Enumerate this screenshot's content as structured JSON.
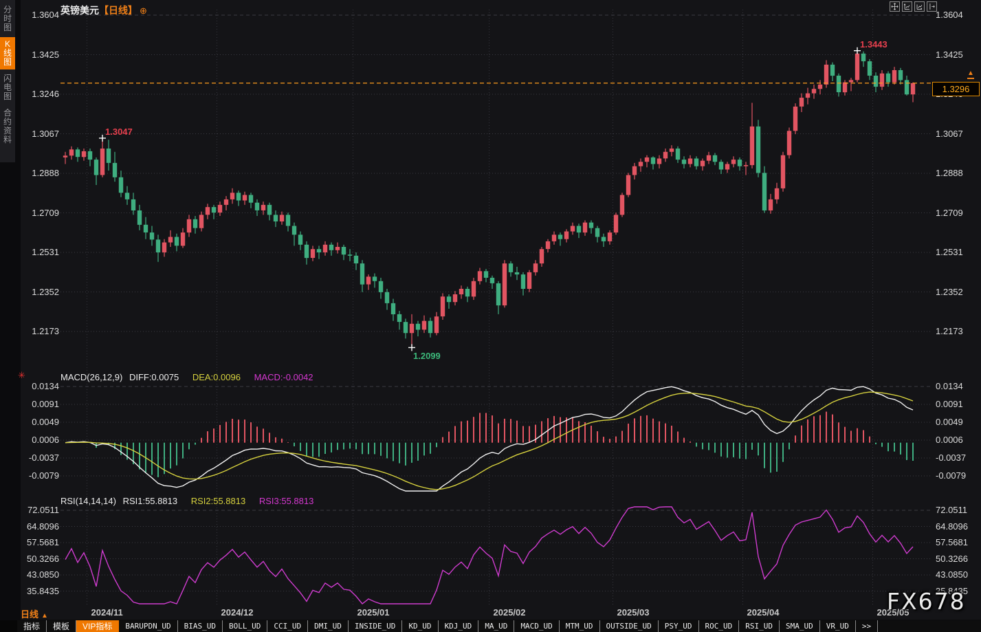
{
  "header": {
    "symbol": "英镑美元",
    "period_tag": "【日线】",
    "target_icon": "⊕"
  },
  "sidebar": {
    "items": [
      {
        "label": "分时图",
        "active": false
      },
      {
        "label": "K线图",
        "active": true
      },
      {
        "label": "闪电图",
        "active": false
      },
      {
        "label": "合约资料",
        "active": false
      }
    ]
  },
  "top_right_icons": [
    {
      "name": "pan-icon"
    },
    {
      "name": "axis-expand-up-icon"
    },
    {
      "name": "axis-expand-right-icon"
    },
    {
      "name": "pane-expand-icon"
    }
  ],
  "main_chart": {
    "axis_labels": [
      "1.3604",
      "1.3425",
      "1.3246",
      "1.3067",
      "1.2888",
      "1.2709",
      "1.2531",
      "1.2352",
      "1.2173"
    ],
    "last_price_label": "1.3296",
    "up_arrow_marker": "▲"
  },
  "macd_panel": {
    "name": "MACD(26,12,9)",
    "diff_label": "DIFF:0.0075",
    "dea_label": "DEA:0.0096",
    "macd_label": "MACD:-0.0042",
    "axis_labels": [
      "0.0134",
      "0.0091",
      "0.0049",
      "0.0006",
      "-0.0037",
      "-0.0079"
    ]
  },
  "rsi_panel": {
    "name": "RSI(14,14,14)",
    "rsi1_label": "RSI1:55.8813",
    "rsi2_label": "RSI2:55.8813",
    "rsi3_label": "RSI3:55.8813",
    "axis_labels": [
      "72.0511",
      "64.8096",
      "57.5681",
      "50.3266",
      "43.0850",
      "35.8435"
    ]
  },
  "xaxis": {
    "timeframe": "日线",
    "timeframe_arrow": "▲",
    "dates": [
      "2024/11",
      "2024/12",
      "2025/01",
      "2025/02",
      "2025/03",
      "2025/04",
      "2025/05"
    ]
  },
  "toolbar": {
    "items": [
      {
        "label": "指标",
        "cn": true
      },
      {
        "label": "模板",
        "cn": true
      },
      {
        "label": "VIP指标",
        "cn": true,
        "active": true
      },
      {
        "label": "BARUPDN_UD"
      },
      {
        "label": "BIAS_UD"
      },
      {
        "label": "BOLL_UD"
      },
      {
        "label": "CCI_UD"
      },
      {
        "label": "DMI_UD"
      },
      {
        "label": "INSIDE_UD"
      },
      {
        "label": "KD_UD"
      },
      {
        "label": "KDJ_UD"
      },
      {
        "label": "MA_UD"
      },
      {
        "label": "MACD_UD"
      },
      {
        "label": "MTM_UD"
      },
      {
        "label": "OUTSIDE_UD"
      },
      {
        "label": "PSY_UD"
      },
      {
        "label": "ROC_UD"
      },
      {
        "label": "RSI_UD"
      },
      {
        "label": "SMA_UD"
      },
      {
        "label": "VR_UD"
      },
      {
        "label": ">>"
      }
    ]
  },
  "watermark": "FX678",
  "colors": {
    "accent_orange": "#f07800",
    "up_red": "#e25562",
    "down_green": "#3fae80",
    "diff_white": "#f2f2f2",
    "dea_yellow": "#d6d13e",
    "rsi_magenta": "#cf3ccf",
    "price_line_orange": "#ff9d1e",
    "annotation_red": "#e8404e",
    "annotation_green": "#3cb87a",
    "grid": "#3a3a42"
  },
  "chart_data": {
    "type": "candlestick",
    "title": "英镑美元 日线 (GBP/USD daily)",
    "price_axis_ticks": [
      1.3604,
      1.3425,
      1.3246,
      1.3067,
      1.2888,
      1.2709,
      1.2531,
      1.2352,
      1.2173
    ],
    "last_price": 1.3296,
    "month_start_indices": [
      4,
      25,
      47,
      69,
      89,
      110,
      131
    ],
    "markers": [
      {
        "candle_index": 6,
        "at": "high",
        "label": "1.3047"
      },
      {
        "candle_index": 128,
        "at": "high",
        "label": "1.3443"
      },
      {
        "candle_index": 56,
        "at": "low",
        "label": "1.2099"
      }
    ],
    "indicators": {
      "macd": {
        "params": [
          26,
          12,
          9
        ],
        "diff": 0.0075,
        "dea": 0.0096,
        "macd": -0.0042,
        "axis_ticks": [
          0.0134,
          0.0091,
          0.0049,
          0.0006,
          -0.0037,
          -0.0079
        ]
      },
      "rsi": {
        "params": [
          14,
          14,
          14
        ],
        "rsi1": 55.8813,
        "rsi2": 55.8813,
        "rsi3": 55.8813,
        "axis_ticks": [
          72.0511,
          64.8096,
          57.5681,
          50.3266,
          43.085,
          35.8435
        ]
      }
    },
    "candles": [
      [
        1.296,
        1.2985,
        1.293,
        1.2968
      ],
      [
        1.2968,
        1.301,
        1.295,
        1.2996
      ],
      [
        1.2996,
        1.3005,
        1.294,
        1.2962
      ],
      [
        1.2962,
        1.3,
        1.2945,
        1.2988
      ],
      [
        1.2988,
        1.3,
        1.292,
        1.295
      ],
      [
        1.295,
        1.296,
        1.2835,
        1.288
      ],
      [
        1.288,
        1.3047,
        1.287,
        1.3
      ],
      [
        1.3,
        1.304,
        1.29,
        1.2935
      ],
      [
        1.2935,
        1.2985,
        1.285,
        1.287
      ],
      [
        1.287,
        1.29,
        1.278,
        1.28
      ],
      [
        1.28,
        1.283,
        1.2745,
        1.277
      ],
      [
        1.277,
        1.28,
        1.27,
        1.272
      ],
      [
        1.272,
        1.2745,
        1.263,
        1.2655
      ],
      [
        1.2655,
        1.269,
        1.259,
        1.262
      ],
      [
        1.262,
        1.265,
        1.256,
        1.2588
      ],
      [
        1.2588,
        1.261,
        1.2487,
        1.253
      ],
      [
        1.253,
        1.259,
        1.251,
        1.2575
      ],
      [
        1.2575,
        1.263,
        1.2555,
        1.26
      ],
      [
        1.26,
        1.2615,
        1.2535,
        1.256
      ],
      [
        1.256,
        1.264,
        1.255,
        1.262
      ],
      [
        1.262,
        1.27,
        1.26,
        1.268
      ],
      [
        1.268,
        1.2695,
        1.2615,
        1.264
      ],
      [
        1.264,
        1.2715,
        1.2625,
        1.27
      ],
      [
        1.27,
        1.275,
        1.268,
        1.2735
      ],
      [
        1.2735,
        1.2745,
        1.268,
        1.271
      ],
      [
        1.271,
        1.276,
        1.2695,
        1.2745
      ],
      [
        1.2745,
        1.2785,
        1.272,
        1.277
      ],
      [
        1.277,
        1.282,
        1.275,
        1.28
      ],
      [
        1.28,
        1.281,
        1.274,
        1.2765
      ],
      [
        1.2765,
        1.2805,
        1.2745,
        1.279
      ],
      [
        1.279,
        1.28,
        1.273,
        1.2755
      ],
      [
        1.2755,
        1.277,
        1.2695,
        1.272
      ],
      [
        1.272,
        1.276,
        1.27,
        1.2745
      ],
      [
        1.2745,
        1.2755,
        1.2675,
        1.27
      ],
      [
        1.27,
        1.272,
        1.2645,
        1.267
      ],
      [
        1.267,
        1.2715,
        1.2655,
        1.27
      ],
      [
        1.27,
        1.271,
        1.2625,
        1.265
      ],
      [
        1.265,
        1.2665,
        1.256,
        1.261
      ],
      [
        1.261,
        1.2625,
        1.254,
        1.2565
      ],
      [
        1.2565,
        1.258,
        1.2475,
        1.2505
      ],
      [
        1.2505,
        1.256,
        1.249,
        1.2545
      ],
      [
        1.2545,
        1.256,
        1.25,
        1.253
      ],
      [
        1.253,
        1.258,
        1.2515,
        1.2565
      ],
      [
        1.2565,
        1.2575,
        1.2515,
        1.254
      ],
      [
        1.254,
        1.2575,
        1.2525,
        1.2555
      ],
      [
        1.2555,
        1.2565,
        1.2495,
        1.252
      ],
      [
        1.252,
        1.2545,
        1.249,
        1.2515
      ],
      [
        1.2515,
        1.253,
        1.245,
        1.248
      ],
      [
        1.248,
        1.2495,
        1.235,
        1.2385
      ],
      [
        1.2385,
        1.243,
        1.236,
        1.242
      ],
      [
        1.242,
        1.2435,
        1.237,
        1.24
      ],
      [
        1.24,
        1.2415,
        1.232,
        1.235
      ],
      [
        1.235,
        1.2365,
        1.227,
        1.23
      ],
      [
        1.23,
        1.232,
        1.222,
        1.225
      ],
      [
        1.225,
        1.2265,
        1.218,
        1.2215
      ],
      [
        1.2215,
        1.223,
        1.214,
        1.2165
      ],
      [
        1.2165,
        1.225,
        1.2099,
        1.2207
      ],
      [
        1.2207,
        1.222,
        1.215,
        1.218
      ],
      [
        1.218,
        1.2245,
        1.2165,
        1.222
      ],
      [
        1.222,
        1.2235,
        1.2145,
        1.2165
      ],
      [
        1.2165,
        1.226,
        1.2155,
        1.224
      ],
      [
        1.224,
        1.2345,
        1.2225,
        1.233
      ],
      [
        1.233,
        1.234,
        1.2275,
        1.2305
      ],
      [
        1.2305,
        1.2355,
        1.229,
        1.234
      ],
      [
        1.234,
        1.238,
        1.232,
        1.2365
      ],
      [
        1.2365,
        1.2375,
        1.2305,
        1.233
      ],
      [
        1.233,
        1.2415,
        1.2315,
        1.24
      ],
      [
        1.24,
        1.246,
        1.2385,
        1.2445
      ],
      [
        1.2445,
        1.2455,
        1.2395,
        1.2415
      ],
      [
        1.2415,
        1.2425,
        1.2365,
        1.239
      ],
      [
        1.239,
        1.24,
        1.225,
        1.229
      ],
      [
        1.229,
        1.2495,
        1.228,
        1.248
      ],
      [
        1.248,
        1.249,
        1.242,
        1.244
      ],
      [
        1.244,
        1.2465,
        1.2405,
        1.243
      ],
      [
        1.243,
        1.244,
        1.2335,
        1.2365
      ],
      [
        1.2365,
        1.245,
        1.235,
        1.244
      ],
      [
        1.244,
        1.2495,
        1.2425,
        1.248
      ],
      [
        1.248,
        1.2555,
        1.2465,
        1.2545
      ],
      [
        1.2545,
        1.259,
        1.253,
        1.258
      ],
      [
        1.258,
        1.2625,
        1.2565,
        1.261
      ],
      [
        1.261,
        1.262,
        1.256,
        1.259
      ],
      [
        1.259,
        1.2635,
        1.2575,
        1.2625
      ],
      [
        1.2625,
        1.2665,
        1.261,
        1.265
      ],
      [
        1.265,
        1.266,
        1.2595,
        1.262
      ],
      [
        1.262,
        1.2675,
        1.2605,
        1.2665
      ],
      [
        1.2665,
        1.2675,
        1.2615,
        1.264
      ],
      [
        1.264,
        1.265,
        1.2575,
        1.26
      ],
      [
        1.26,
        1.2615,
        1.2555,
        1.258
      ],
      [
        1.258,
        1.263,
        1.2565,
        1.262
      ],
      [
        1.262,
        1.271,
        1.261,
        1.27
      ],
      [
        1.27,
        1.28,
        1.269,
        1.279
      ],
      [
        1.279,
        1.289,
        1.278,
        1.288
      ],
      [
        1.288,
        1.2935,
        1.286,
        1.292
      ],
      [
        1.292,
        1.2955,
        1.2895,
        1.294
      ],
      [
        1.294,
        1.297,
        1.2915,
        1.296
      ],
      [
        1.296,
        1.2965,
        1.2905,
        1.293
      ],
      [
        1.293,
        1.297,
        1.291,
        1.2955
      ],
      [
        1.2955,
        1.3,
        1.294,
        1.2985
      ],
      [
        1.2985,
        1.3015,
        1.2965,
        1.3
      ],
      [
        1.3,
        1.301,
        1.2935,
        1.295
      ],
      [
        1.295,
        1.2965,
        1.291,
        1.293
      ],
      [
        1.293,
        1.297,
        1.2915,
        1.2955
      ],
      [
        1.2955,
        1.2965,
        1.2905,
        1.292
      ],
      [
        1.292,
        1.2955,
        1.29,
        1.2945
      ],
      [
        1.2945,
        1.2985,
        1.293,
        1.297
      ],
      [
        1.297,
        1.298,
        1.2925,
        1.294
      ],
      [
        1.294,
        1.295,
        1.2885,
        1.2905
      ],
      [
        1.2905,
        1.294,
        1.289,
        1.293
      ],
      [
        1.293,
        1.2965,
        1.2915,
        1.295
      ],
      [
        1.295,
        1.296,
        1.29,
        1.292
      ],
      [
        1.292,
        1.294,
        1.288,
        1.2925
      ],
      [
        1.2925,
        1.3207,
        1.291,
        1.31
      ],
      [
        1.31,
        1.313,
        1.287,
        1.289
      ],
      [
        1.289,
        1.292,
        1.2709,
        1.272
      ],
      [
        1.272,
        1.2795,
        1.2705,
        1.277
      ],
      [
        1.277,
        1.2845,
        1.275,
        1.282
      ],
      [
        1.282,
        1.2985,
        1.2805,
        1.297
      ],
      [
        1.297,
        1.3095,
        1.2955,
        1.308
      ],
      [
        1.308,
        1.3205,
        1.3065,
        1.319
      ],
      [
        1.319,
        1.325,
        1.3165,
        1.323
      ],
      [
        1.323,
        1.3275,
        1.32,
        1.325
      ],
      [
        1.325,
        1.329,
        1.3225,
        1.327
      ],
      [
        1.327,
        1.331,
        1.3245,
        1.329
      ],
      [
        1.329,
        1.34,
        1.3275,
        1.338
      ],
      [
        1.338,
        1.339,
        1.3305,
        1.333
      ],
      [
        1.333,
        1.334,
        1.3235,
        1.3255
      ],
      [
        1.3255,
        1.331,
        1.324,
        1.33
      ],
      [
        1.33,
        1.332,
        1.326,
        1.331
      ],
      [
        1.331,
        1.3443,
        1.33,
        1.343
      ],
      [
        1.343,
        1.344,
        1.337,
        1.3395
      ],
      [
        1.3395,
        1.3405,
        1.331,
        1.333
      ],
      [
        1.333,
        1.3345,
        1.3255,
        1.328
      ],
      [
        1.328,
        1.3355,
        1.3265,
        1.334
      ],
      [
        1.334,
        1.335,
        1.328,
        1.33
      ],
      [
        1.33,
        1.337,
        1.329,
        1.3355
      ],
      [
        1.3355,
        1.3365,
        1.329,
        1.331
      ],
      [
        1.331,
        1.333,
        1.324,
        1.3245
      ],
      [
        1.3245,
        1.33,
        1.321,
        1.3296
      ]
    ]
  }
}
